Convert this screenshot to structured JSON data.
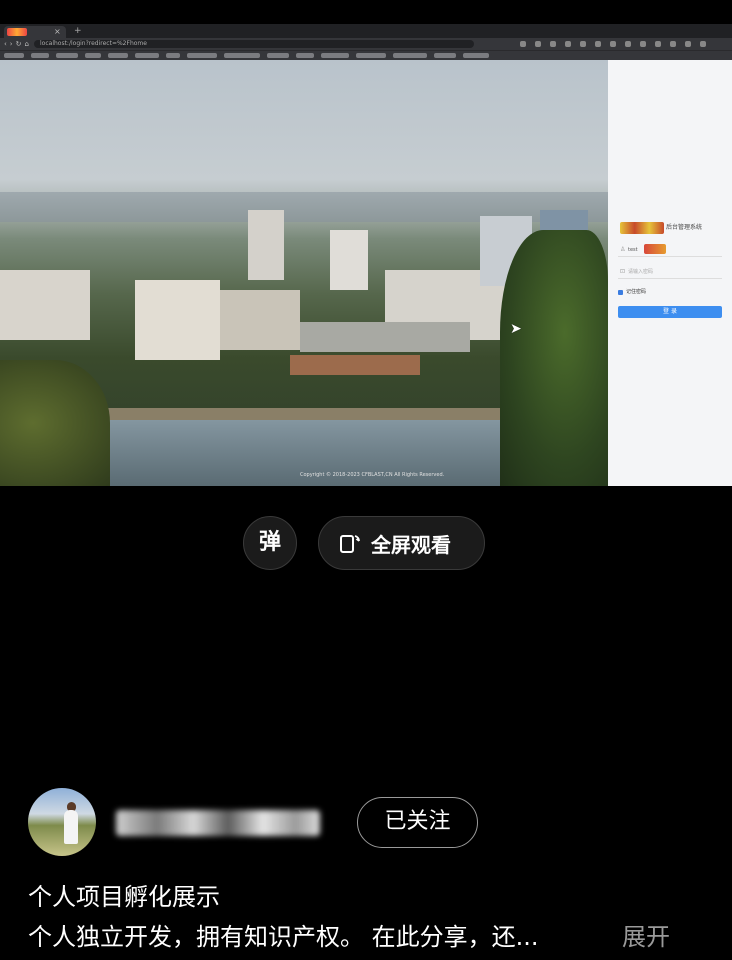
{
  "browser": {
    "url": "localhost:/login?redirect=%2Fhome"
  },
  "login_page": {
    "system_title": "后台管理系统",
    "username_value": "test",
    "password_placeholder": "请输入密码",
    "remember_label": "记住密码",
    "login_button": "登 录",
    "copyright": "Copyright © 2018-2023 CFBLAST,CN All Rights Reserved."
  },
  "player": {
    "danmu_label": "弹",
    "fullscreen_label": "全屏观看"
  },
  "author": {
    "follow_label": "已关注"
  },
  "post": {
    "title": "个人项目孵化展示",
    "description": "个人独立开发，拥有知识产权。 在此分享，还...",
    "expand_label": "展开"
  }
}
